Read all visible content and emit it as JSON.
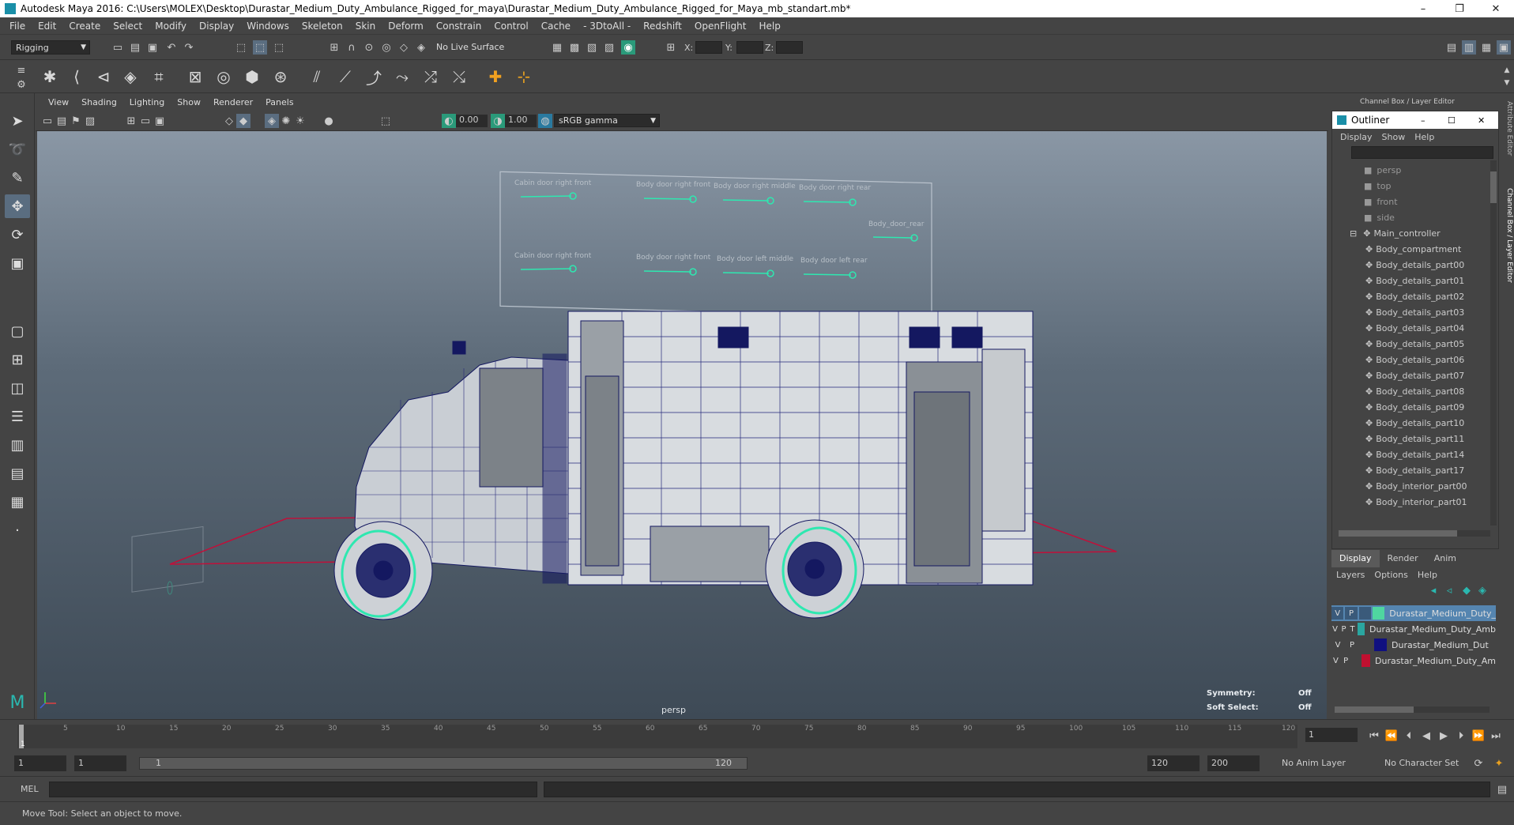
{
  "window": {
    "title": "Autodesk Maya 2016: C:\\Users\\MOLEX\\Desktop\\Durastar_Medium_Duty_Ambulance_Rigged_for_maya\\Durastar_Medium_Duty_Ambulance_Rigged_for_Maya_mb_standart.mb*",
    "minimize": "–",
    "maximize": "❐",
    "close": "✕"
  },
  "menu": [
    "File",
    "Edit",
    "Create",
    "Select",
    "Modify",
    "Display",
    "Windows",
    "Skeleton",
    "Skin",
    "Deform",
    "Constrain",
    "Control",
    "Cache",
    "- 3DtoAll -",
    "Redshift",
    "OpenFlight",
    "Help"
  ],
  "status": {
    "mode": "Rigging",
    "live_surface": "No Live Surface",
    "x_label": "X:",
    "y_label": "Y:",
    "z_label": "Z:"
  },
  "viewport": {
    "menu": [
      "View",
      "Shading",
      "Lighting",
      "Show",
      "Renderer",
      "Panels"
    ],
    "exposure": "0.00",
    "gamma": "1.00",
    "color_space": "sRGB gamma",
    "camera_label": "persp",
    "symmetry_label": "Symmetry:",
    "symmetry_value": "Off",
    "soft_select_label": "Soft Select:",
    "soft_select_value": "Off",
    "controls": {
      "top": [
        "Cabin door right front",
        "Body door right front",
        "Body door right middle",
        "Body door right rear"
      ],
      "bottom": [
        "Cabin door right front",
        "Body door right front",
        "Body door left middle",
        "Body door left rear"
      ],
      "side": "Body_door_rear"
    }
  },
  "right_panel": {
    "header": "Channel Box / Layer Editor",
    "outliner_title": "Outliner",
    "outliner_menu": [
      "Display",
      "Show",
      "Help"
    ],
    "cameras": [
      "persp",
      "top",
      "front",
      "side"
    ],
    "root": "Main_controller",
    "children": [
      "Body_compartment",
      "Body_details_part00",
      "Body_details_part01",
      "Body_details_part02",
      "Body_details_part03",
      "Body_details_part04",
      "Body_details_part05",
      "Body_details_part06",
      "Body_details_part07",
      "Body_details_part08",
      "Body_details_part09",
      "Body_details_part10",
      "Body_details_part11",
      "Body_details_part14",
      "Body_details_part17",
      "Body_interior_part00",
      "Body_interior_part01"
    ],
    "tabs": [
      "Display",
      "Render",
      "Anim"
    ],
    "layer_menu": [
      "Layers",
      "Options",
      "Help"
    ],
    "layers": [
      {
        "v": "V",
        "p": "P",
        "t": "",
        "name": "Durastar_Medium_Duty_",
        "color": "#4fd6a0",
        "selected": true
      },
      {
        "v": "V",
        "p": "P",
        "t": "T",
        "name": "Durastar_Medium_Duty_Amb",
        "color": "#2aa6a0",
        "selected": false
      },
      {
        "v": "V",
        "p": "P",
        "t": "",
        "name": "Durastar_Medium_Dut",
        "color": "#101080",
        "selected": false
      },
      {
        "v": "V",
        "p": "P",
        "t": "",
        "name": "Durastar_Medium_Duty_Am",
        "color": "#c01030",
        "selected": false
      }
    ],
    "side_tabs": [
      "Attribute Editor",
      "Channel Box / Layer Editor"
    ]
  },
  "timeline": {
    "ticks": [
      "1",
      "5",
      "10",
      "15",
      "20",
      "25",
      "30",
      "35",
      "40",
      "45",
      "50",
      "55",
      "60",
      "65",
      "70",
      "75",
      "80",
      "85",
      "90",
      "95",
      "100",
      "105",
      "110",
      "115",
      "120"
    ],
    "current_frame": "1",
    "range_start": "1",
    "range_start2": "1",
    "range_inner_start": "1",
    "range_inner_end": "120",
    "range_end": "120",
    "range_end2": "200",
    "anim_layer": "No Anim Layer",
    "character_set": "No Character Set"
  },
  "command": {
    "label": "MEL"
  },
  "help_line": "Move Tool: Select an object to move."
}
